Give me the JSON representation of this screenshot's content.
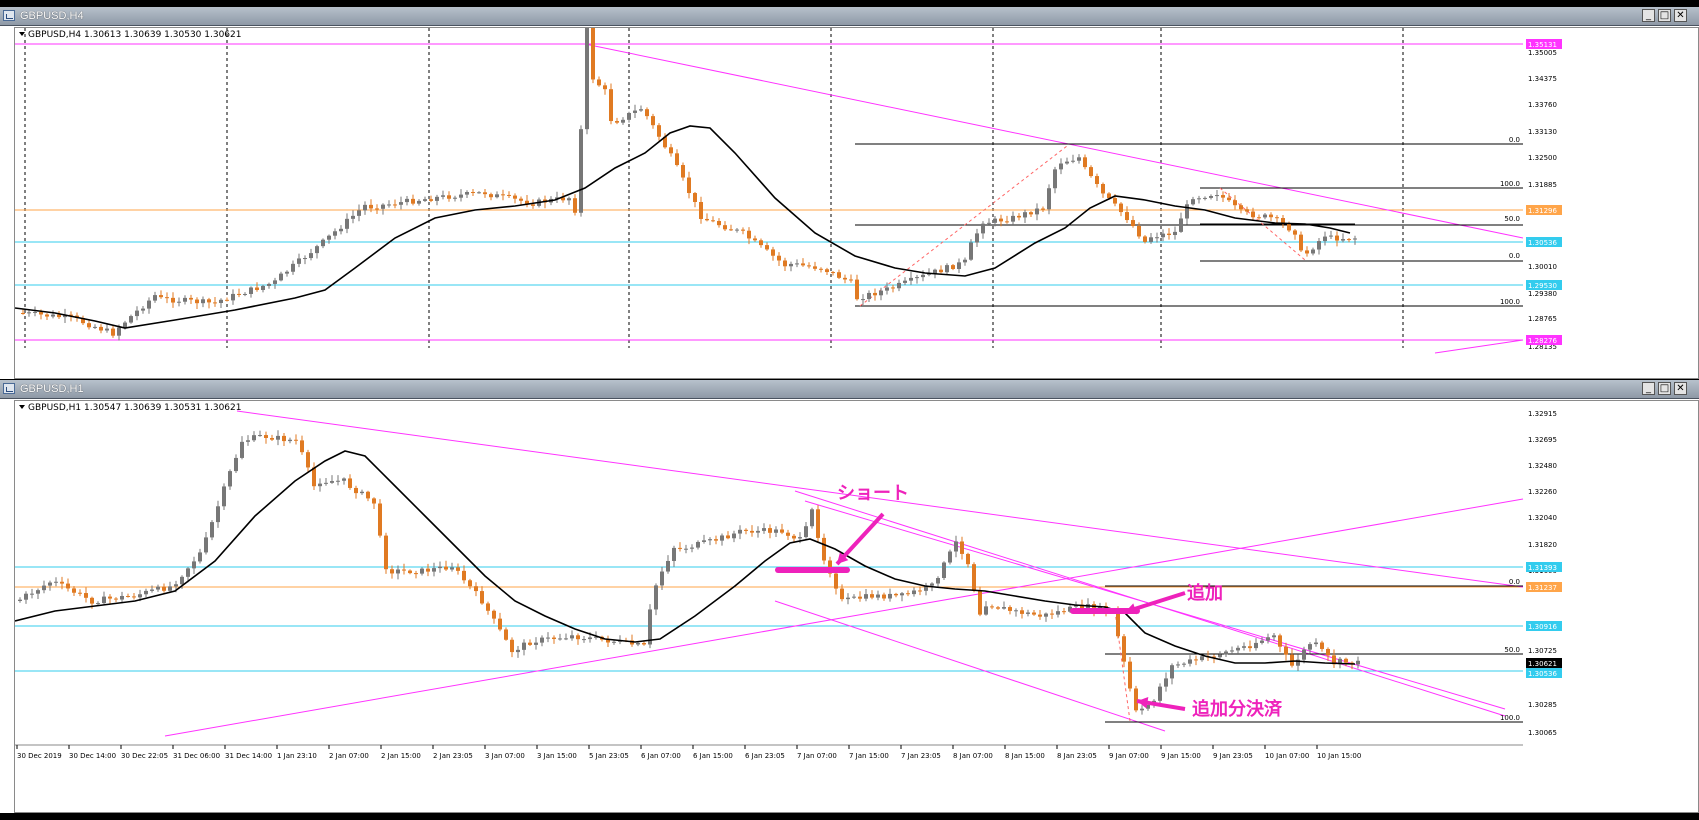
{
  "colors": {
    "magenta": "#ff33ff",
    "cyan": "#33ccee",
    "orange_level": "#ffa54a",
    "bull_candle": "#777777",
    "bear_candle": "#e07a22",
    "ma_line": "#000000",
    "annotation": "#ee22bb"
  },
  "top_window": {
    "title": "GBPUSD,H4",
    "info": "GBPUSD,H4  1.30613 1.30639 1.30530 1.30621",
    "buttons": {
      "minimize": "_",
      "maximize": "□",
      "close": "✕"
    },
    "price_axis": [
      "1.35005",
      "1.34375",
      "1.33760",
      "1.33130",
      "1.32500",
      "1.31885",
      "1.30640",
      "1.30010",
      "1.29380",
      "1.28765",
      "1.28135"
    ],
    "price_tags": [
      {
        "value": "1.35131",
        "color": "#ff33ff"
      },
      {
        "value": "1.31296",
        "color": "#ffa54a"
      },
      {
        "value": "1.30536",
        "color": "#33ccee"
      },
      {
        "value": "1.29530",
        "color": "#33ccee"
      },
      {
        "value": "1.28276",
        "color": "#ff33ff"
      }
    ],
    "fib_labels": [
      "0.0",
      "100.0",
      "50.0",
      "0.0",
      "100.0"
    ]
  },
  "bottom_window": {
    "title": "GBPUSD,H1",
    "info": "GBPUSD,H1  1.30547 1.30639 1.30531 1.30621",
    "buttons": {
      "minimize": "_",
      "maximize": "□",
      "close": "✕"
    },
    "price_axis": [
      "1.32915",
      "1.32695",
      "1.32480",
      "1.32260",
      "1.32040",
      "1.31820",
      "1.31600",
      "1.31160",
      "1.30725",
      "1.30285",
      "1.30065"
    ],
    "price_tags": [
      {
        "value": "1.31393",
        "color": "#33ccee"
      },
      {
        "value": "1.31237",
        "color": "#ffa54a"
      },
      {
        "value": "1.30916",
        "color": "#33ccee"
      },
      {
        "value": "1.30621",
        "color": "#000000"
      },
      {
        "value": "1.30536",
        "color": "#33ccee"
      }
    ],
    "fib_labels": [
      "0.0",
      "50.0",
      "100.0"
    ],
    "time_axis": [
      "30 Dec 2019",
      "30 Dec 14:00",
      "30 Dec 22:05",
      "31 Dec 06:00",
      "31 Dec 14:00",
      "1 Jan 23:10",
      "2 Jan 07:00",
      "2 Jan 15:00",
      "2 Jan 23:05",
      "3 Jan 07:00",
      "3 Jan 15:00",
      "5 Jan 23:05",
      "6 Jan 07:00",
      "6 Jan 15:00",
      "6 Jan 23:05",
      "7 Jan 07:00",
      "7 Jan 15:00",
      "7 Jan 23:05",
      "8 Jan 07:00",
      "8 Jan 15:00",
      "8 Jan 23:05",
      "9 Jan 07:00",
      "9 Jan 15:00",
      "9 Jan 23:05",
      "10 Jan 07:00",
      "10 Jan 15:00"
    ],
    "annotations": {
      "short": "ショート",
      "add": "追加",
      "close_added": "追加分決済"
    }
  }
}
